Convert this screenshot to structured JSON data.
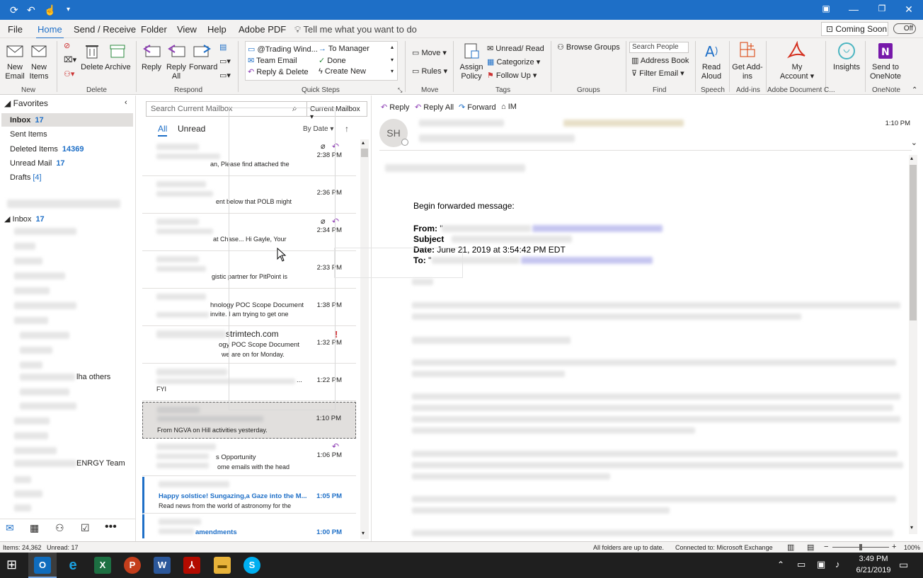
{
  "menu": {
    "tabs": [
      "File",
      "Home",
      "Send / Receive",
      "Folder",
      "View",
      "Help",
      "Adobe PDF"
    ],
    "tell_me": "Tell me what you want to do",
    "coming_soon": "Coming Soon",
    "toggle": "Off"
  },
  "ribbon": {
    "new_email": "New Email",
    "new_items": "New Items",
    "delete": "Delete",
    "archive": "Archive",
    "reply": "Reply",
    "reply_all": "Reply All",
    "forward": "Forward",
    "qs_trading": "@Trading Wind...",
    "qs_team": "Team Email",
    "qs_reply_delete": "Reply & Delete",
    "qs_manager": "To Manager",
    "qs_done": "Done",
    "qs_create": "Create New",
    "move": "Move",
    "rules": "Rules",
    "assign_policy": "Assign Policy",
    "unread_read": "Unread/ Read",
    "categorize": "Categorize",
    "follow_up": "Follow Up",
    "browse_groups": "Browse Groups",
    "search_people": "Search People",
    "address_book": "Address Book",
    "filter_email": "Filter Email",
    "read_aloud": "Read Aloud",
    "get_addins": "Get Add-ins",
    "my_account": "My Account",
    "insights": "Insights",
    "send_onenote": "Send to OneNote",
    "groups": {
      "new": "New",
      "delete": "Delete",
      "respond": "Respond",
      "quick_steps": "Quick Steps",
      "move": "Move",
      "tags": "Tags",
      "groups": "Groups",
      "find": "Find",
      "speech": "Speech",
      "addins": "Add-ins",
      "adobe": "Adobe Document C...",
      "onenote": "OneNote"
    }
  },
  "nav": {
    "favorites": "Favorites",
    "inbox": "Inbox",
    "inbox_count": "17",
    "sent": "Sent Items",
    "deleted": "Deleted Items",
    "deleted_count": "14369",
    "unread": "Unread Mail",
    "unread_count": "17",
    "drafts": "Drafts",
    "drafts_count": "[4]",
    "inbox2": "Inbox",
    "inbox2_count": "17",
    "others_suffix": "lha others",
    "team_suffix": "ENRGY Team"
  },
  "list": {
    "search_placeholder": "Search Current Mailbox",
    "scope": "Current Mailbox",
    "filter_all": "All",
    "filter_unread": "Unread",
    "sort": "By Date",
    "messages": [
      {
        "time": "2:38 PM",
        "subject": "",
        "preview": "an,  Please find attached the",
        "sender": ""
      },
      {
        "time": "2:36 PM",
        "subject": "",
        "preview": "ent below that POLB might",
        "sender": ""
      },
      {
        "time": "2:34 PM",
        "subject": "",
        "preview": "at Chase...  Hi Gayle,  Your",
        "sender": ""
      },
      {
        "time": "2:33 PM",
        "subject": "",
        "preview": "gistic partner for PitPoint is",
        "sender": ""
      },
      {
        "time": "1:38 PM",
        "subject": "hnology POC Scope Document",
        "preview": "invite. I am trying to get one",
        "sender": ""
      },
      {
        "time": "1:32 PM",
        "subject": "ogy POC Scope Document",
        "preview": "we are on for Monday.",
        "sender": "strimtech.com"
      },
      {
        "time": "1:22 PM",
        "subject": "...",
        "preview": "FYI",
        "sender": ""
      },
      {
        "time": "1:10 PM",
        "subject": "",
        "preview": "From NGVA on Hill activities yesterday.",
        "sender": ""
      },
      {
        "time": "1:06 PM",
        "subject": "s Opportunity",
        "preview": "ome emails with the head",
        "sender": ""
      },
      {
        "time": "1:05 PM",
        "subject": "Happy solstice! Sungazing,a Gaze into the M...",
        "preview": "Read news from the world of astronomy for the",
        "sender": ""
      },
      {
        "time": "1:00 PM",
        "subject": "amendments",
        "preview": "",
        "sender": ""
      }
    ]
  },
  "reading": {
    "reply": "Reply",
    "reply_all": "Reply All",
    "forward": "Forward",
    "im": "IM",
    "avatar": "SH",
    "time": "1:10 PM",
    "begin": "Begin forwarded message:",
    "from_label": "From:",
    "subject_label": "Subject",
    "date_label": "Date:",
    "date_value": "June 21, 2019 at 3:54:42 PM EDT",
    "to_label": "To:"
  },
  "status": {
    "items": "Items: 24,362",
    "unread": "Unread: 17",
    "sync": "All folders are up to date.",
    "connected": "Connected to: Microsoft Exchange",
    "zoom": "100%"
  },
  "taskbar": {
    "time": "3:49 PM",
    "date": "6/21/2019"
  }
}
